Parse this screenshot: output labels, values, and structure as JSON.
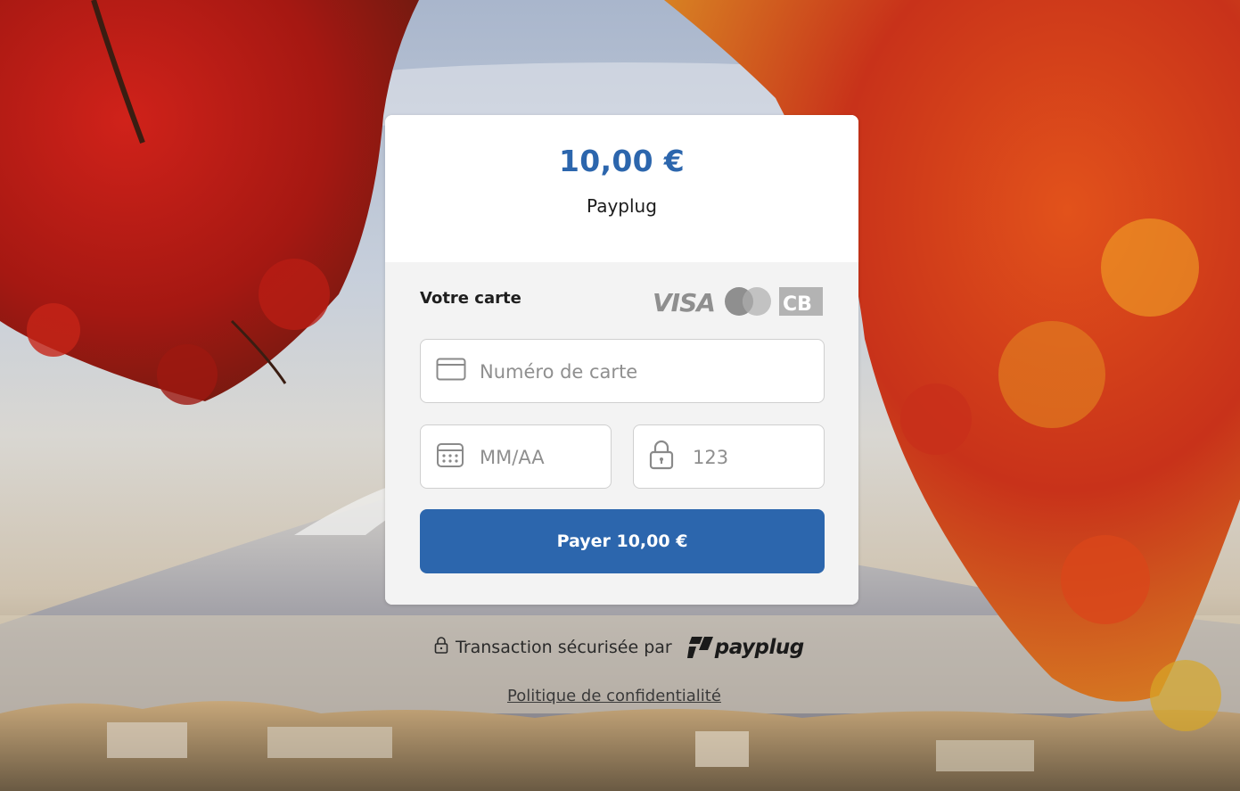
{
  "header": {
    "amount": "10,00 €",
    "merchant": "Payplug"
  },
  "form": {
    "card_label": "Votre carte",
    "brands": [
      "VISA",
      "mastercard",
      "CB"
    ],
    "card_number_placeholder": "Numéro de carte",
    "expiry_placeholder": "MM/AA",
    "cvc_placeholder": "123",
    "pay_button_label": "Payer 10,00 €"
  },
  "footer": {
    "secure_text": "Transaction sécurisée par",
    "provider_logo": "payplug",
    "privacy_link": "Politique de confidentialité"
  },
  "colors": {
    "accent": "#2c66ad",
    "panel": "#f3f3f3",
    "input_border": "#cfcfcf"
  },
  "icons": {
    "card_field": "credit-card-icon",
    "expiry_field": "calendar-icon",
    "cvc_field": "lock-icon",
    "secure": "padlock-icon"
  }
}
